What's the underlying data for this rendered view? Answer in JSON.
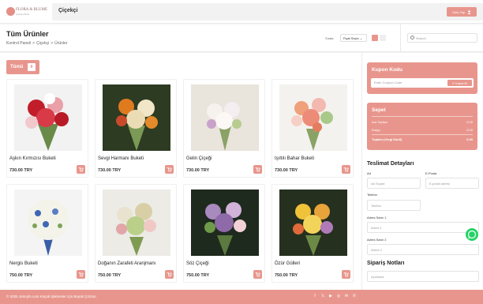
{
  "brand": {
    "name": "FLORA & BLUME",
    "tagline": "Çiçekçi Butik"
  },
  "top": {
    "shop_title": "Çiçekçi",
    "login_label": "Giriş Yap"
  },
  "header": {
    "page_title": "Tüm Ürünler",
    "breadcrumb": [
      "Kontrol Paneli",
      ">",
      "Çiçekçi",
      ">",
      "Ürünler"
    ],
    "sort_label": "Sırala",
    "sort_value": "Fiyat Seçin",
    "search_placeholder": "Search"
  },
  "category": {
    "label": "Tümü",
    "count": "8"
  },
  "products": [
    {
      "name": "Aşkın Kırmızısı Buketi",
      "price": "730.00 TRY"
    },
    {
      "name": "Sevgi Harmanı Buketi",
      "price": "730.00 TRY"
    },
    {
      "name": "Gelin Çiçeği",
      "price": "730.00 TRY"
    },
    {
      "name": "Işıltılı Bahar Buketi",
      "price": "730.00 TRY"
    },
    {
      "name": "Nergis Buketi",
      "price": "750.00 TRY"
    },
    {
      "name": "Doğanın Zarafeti Aranjmanı",
      "price": "750.00 TRY"
    },
    {
      "name": "Söz Çiçeği",
      "price": "750.00 TRY"
    },
    {
      "name": "Özür Gülleri",
      "price": "750.00 TRY"
    }
  ],
  "coupon": {
    "title": "Kupon Kodu",
    "placeholder": "Enter Coupon Code",
    "apply_label": "Kabul Et"
  },
  "cart": {
    "title": "Sepet",
    "rows": [
      {
        "label": "Ara Toplam",
        "value": "0.00"
      },
      {
        "label": "Kargo",
        "value": "0.00"
      },
      {
        "label": "Toplam (Vergi Dahil)",
        "value": "0.00"
      }
    ]
  },
  "delivery": {
    "title": "Teslimat Detayları",
    "name_label": "Ad",
    "name_placeholder": "Ad Soyad",
    "email_label": "E-Posta",
    "email_placeholder": "E-posta adresi",
    "phone_label": "Telefon",
    "phone_placeholder": "Telefon",
    "addr1_label": "Adres Satırı 1",
    "addr1_placeholder": "Adres 1",
    "addr2_label": "Adres Satırı 2",
    "addr2_placeholder": "Adres 2"
  },
  "notes": {
    "title": "Sipariş Notları",
    "placeholder": "Açıklama"
  },
  "footer": {
    "text": "© 2025 Jetmyfo.com Küçük İşletmeler İçin Büyük Çözüm."
  },
  "colors": {
    "accent": "#e8968d",
    "whatsapp": "#25d366"
  }
}
